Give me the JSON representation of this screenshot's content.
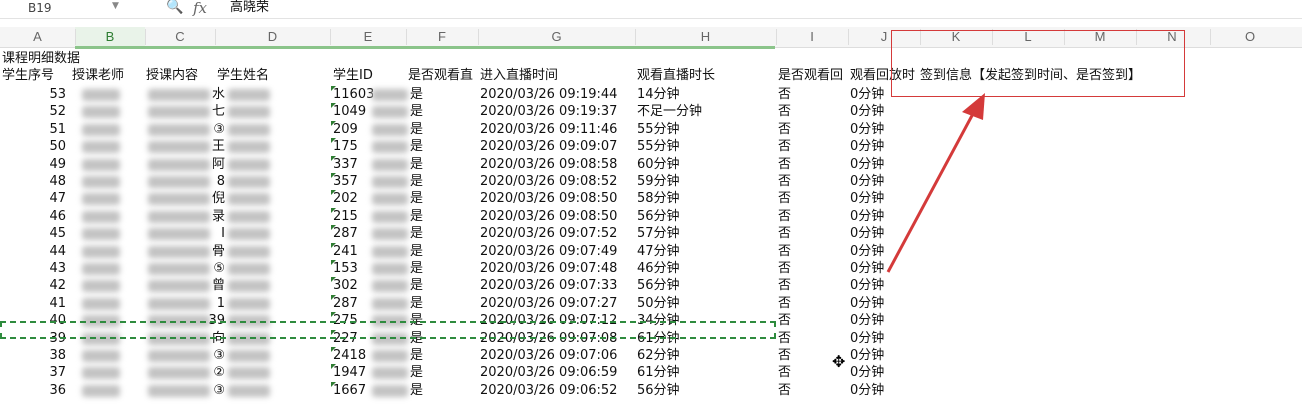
{
  "formula_bar": {
    "name_box": "B19",
    "fx_label": "fx",
    "zoom_icon": "🔍",
    "value": "高晓荣"
  },
  "columns": [
    "A",
    "B",
    "C",
    "D",
    "E",
    "F",
    "G",
    "H",
    "I",
    "J",
    "K",
    "L",
    "M",
    "N",
    "O"
  ],
  "active_column": "B",
  "sheet": {
    "title": "课程明细数据",
    "headers": {
      "a": "学生序号",
      "b": "授课老师",
      "c": "授课内容",
      "d": "学生姓名",
      "e": "学生ID",
      "f": "是否观看直",
      "g": "进入直播时间",
      "h": "观看直播时长",
      "i": "是否观看回",
      "j": "观看回放时",
      "k": "签到信息【发起签到时间、是否签到】"
    },
    "rows": [
      {
        "seq": "53",
        "d": "水",
        "e": "11603",
        "f": "是",
        "g": "2020/03/26  09:19:44",
        "h": "14分钟",
        "i": "否",
        "j": "0分钟"
      },
      {
        "seq": "52",
        "d": "七",
        "e": "1049",
        "f": "是",
        "g": "2020/03/26  09:19:37",
        "h": "不足一分钟",
        "i": "否",
        "j": "0分钟"
      },
      {
        "seq": "51",
        "d": "③",
        "e": "209",
        "f": "是",
        "g": "2020/03/26  09:11:46",
        "h": "55分钟",
        "i": "否",
        "j": "0分钟"
      },
      {
        "seq": "50",
        "d": "王",
        "e": "175",
        "f": "是",
        "g": "2020/03/26  09:09:07",
        "h": "55分钟",
        "i": "否",
        "j": "0分钟"
      },
      {
        "seq": "49",
        "d": "阿",
        "e": "337",
        "f": "是",
        "g": "2020/03/26  09:08:58",
        "h": "60分钟",
        "i": "否",
        "j": "0分钟"
      },
      {
        "seq": "48",
        "d": "8",
        "e": "357",
        "f": "是",
        "g": "2020/03/26  09:08:52",
        "h": "59分钟",
        "i": "否",
        "j": "0分钟"
      },
      {
        "seq": "47",
        "d": "倪",
        "e": "202",
        "f": "是",
        "g": "2020/03/26  09:08:50",
        "h": "58分钟",
        "i": "否",
        "j": "0分钟"
      },
      {
        "seq": "46",
        "d": "录",
        "e": "215",
        "f": "是",
        "g": "2020/03/26  09:08:50",
        "h": "56分钟",
        "i": "否",
        "j": "0分钟"
      },
      {
        "seq": "45",
        "d": "I",
        "e": "287",
        "f": "是",
        "g": "2020/03/26  09:07:52",
        "h": "57分钟",
        "i": "否",
        "j": "0分钟"
      },
      {
        "seq": "44",
        "d": "骨",
        "e": "241",
        "f": "是",
        "g": "2020/03/26  09:07:49",
        "h": "47分钟",
        "i": "否",
        "j": "0分钟"
      },
      {
        "seq": "43",
        "d": "⑤",
        "e": "153",
        "f": "是",
        "g": "2020/03/26  09:07:48",
        "h": "46分钟",
        "i": "否",
        "j": "0分钟"
      },
      {
        "seq": "42",
        "d": "曾",
        "e": "302",
        "f": "是",
        "g": "2020/03/26  09:07:33",
        "h": "56分钟",
        "i": "否",
        "j": "0分钟"
      },
      {
        "seq": "41",
        "d": "1",
        "e": "287",
        "f": "是",
        "g": "2020/03/26  09:07:27",
        "h": "50分钟",
        "i": "否",
        "j": "0分钟"
      },
      {
        "seq": "40",
        "d": "39",
        "e": "275",
        "f": "是",
        "g": "2020/03/26  09:07:12",
        "h": "34分钟",
        "i": "否",
        "j": "0分钟"
      },
      {
        "seq": "39",
        "d": "向",
        "e": "227",
        "f": "是",
        "g": "2020/03/26  09:07:08",
        "h": "61分钟",
        "i": "否",
        "j": "0分钟"
      },
      {
        "seq": "38",
        "d": "③",
        "e": "2418",
        "f": "是",
        "g": "2020/03/26  09:07:06",
        "h": "62分钟",
        "i": "否",
        "j": "0分钟"
      },
      {
        "seq": "37",
        "d": "②",
        "e": "1947",
        "f": "是",
        "g": "2020/03/26  09:06:59",
        "h": "61分钟",
        "i": "否",
        "j": "0分钟"
      },
      {
        "seq": "36",
        "d": "③",
        "e": "1667",
        "f": "是",
        "g": "2020/03/26  09:06:52",
        "h": "56分钟",
        "i": "否",
        "j": "0分钟"
      }
    ]
  },
  "colors": {
    "accent": "#2e7d32",
    "annotation": "#d43a3a"
  }
}
